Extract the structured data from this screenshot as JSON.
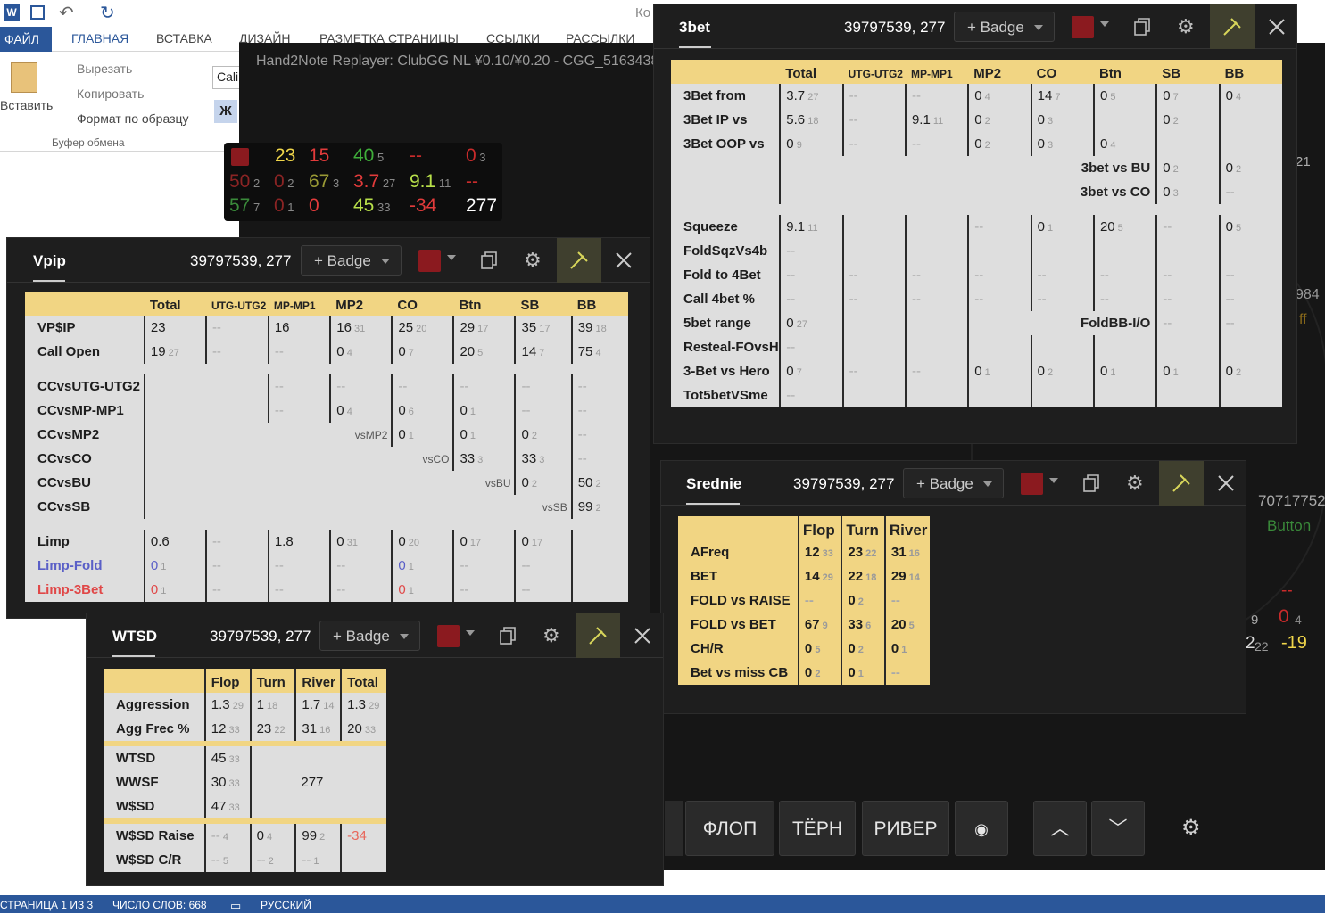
{
  "word": {
    "tabs": [
      "ФАЙЛ",
      "ГЛАВНАЯ",
      "ВСТАВКА",
      "ДИЗАЙН",
      "РАЗМЕТКА СТРАНИЦЫ",
      "ССЫЛКИ",
      "РАССЫЛКИ"
    ],
    "title_partial": "Ко",
    "paste": "Вставить",
    "cut": "Вырезать",
    "copy": "Копировать",
    "format": "Формат по образцу",
    "group": "Буфер обмена",
    "font_partial": "Cali",
    "bold": "Ж",
    "status": {
      "page": "СТРАНИЦА 1 ИЗ 3",
      "words": "ЧИСЛО СЛОВ: 668",
      "lang": "РУССКИЙ"
    }
  },
  "replayer": {
    "title": "Hand2Note Replayer: ClubGG NL ¥0.10/¥0.20 - CGG_5163438",
    "hud": [
      {
        "v": "23",
        "c": "#f0d64a"
      },
      {
        "v": "15",
        "c": "#e23b3b"
      },
      {
        "v": "40",
        "n": "5",
        "c": "#3fae3a"
      },
      {
        "v": "--",
        "c": "#c92b2b"
      },
      {
        "v": "0",
        "n": "3",
        "c": "#c92b2b"
      },
      {
        "v": "50",
        "n": "2",
        "c": "#8b2424"
      },
      {
        "v": "0",
        "n": "2",
        "c": "#8b2424"
      },
      {
        "v": "67",
        "n": "3",
        "c": "#9a9a35"
      },
      {
        "v": "3.7",
        "n": "27",
        "c": "#e23b3b"
      },
      {
        "v": "9.1",
        "n": "11",
        "c": "#b8e04a"
      },
      {
        "v": "--",
        "c": "#c92b2b"
      },
      {
        "v": "57",
        "n": "7",
        "c": "#3a8a3a"
      },
      {
        "v": "0",
        "n": "1",
        "c": "#8b2424"
      },
      {
        "v": "0",
        "c": "#e23b3b"
      },
      {
        "v": "45",
        "n": "33",
        "c": "#b8e04a"
      },
      {
        "v": "-34",
        "c": "#e23b3b"
      },
      {
        "v": "277",
        "c": "#ffffff"
      }
    ],
    "side_texts": [
      "21",
      "984",
      "ff",
      "70717752",
      "Button",
      "--",
      "9",
      "0",
      "4",
      "2",
      "22",
      "-19"
    ],
    "buttons": [
      "ФЛОП",
      "ТЁРН",
      "РИВЕР"
    ]
  },
  "popups": {
    "id": "39797539, 277",
    "badge": "+ Badge",
    "vpip": {
      "title": "Vpip",
      "header": [
        "Total",
        "UTG-UTG2",
        "MP-MP1",
        "MP2",
        "CO",
        "Btn",
        "SB",
        "BB"
      ],
      "rows": [
        [
          "VP$IP",
          "23",
          "",
          "--",
          "",
          "16",
          "",
          "16",
          "31",
          "25",
          "20",
          "29",
          "17",
          "35",
          "17",
          "39",
          "18"
        ],
        [
          "Call Open",
          "19",
          "27",
          "--",
          "",
          "--",
          "",
          "0",
          "4",
          "0",
          "7",
          "20",
          "5",
          "14",
          "7",
          "75",
          "4"
        ]
      ],
      "cc_rows": [
        [
          "CCvsUTG-UTG2",
          "--",
          "--",
          "--",
          "--",
          "--",
          "--"
        ],
        [
          "CCvsMP-MP1",
          "--",
          "0|4",
          "0|6",
          "0|1",
          "--",
          "--"
        ],
        [
          "CCvsMP2",
          "vsMP2",
          "0|1",
          "0|1",
          "0|2",
          "--"
        ],
        [
          "CCvsCO",
          "vsCO",
          "33|3",
          "33|3",
          "--"
        ],
        [
          "CCvsBU",
          "vsBU",
          "0|2",
          "50|2"
        ],
        [
          "CCvsSB",
          "vsSB",
          "99|2"
        ]
      ],
      "limp_rows": [
        [
          "Limp",
          "0.6",
          "",
          "--",
          "",
          "1.8",
          "",
          "0",
          "31",
          "0",
          "20",
          "0",
          "17",
          "0",
          "17",
          "",
          ""
        ],
        [
          "Limp-Fold",
          "0",
          "1",
          "--",
          "",
          "--",
          "",
          "--",
          "",
          "0",
          "1",
          "--",
          "",
          "--",
          "",
          "",
          ""
        ],
        [
          "Limp-3Bet",
          "0",
          "1",
          "--",
          "",
          "--",
          "",
          "--",
          "",
          "0",
          "1",
          "--",
          "",
          "--",
          "",
          "",
          ""
        ]
      ]
    },
    "threebet": {
      "title": "3bet",
      "header": [
        "Total",
        "UTG-UTG2",
        "MP-MP1",
        "MP2",
        "CO",
        "Btn",
        "SB",
        "BB"
      ],
      "rows": [
        [
          "3Bet from",
          "3.7|27",
          "--",
          "--",
          "0|4",
          "14|7",
          "0|5",
          "0|7",
          "0|4"
        ],
        [
          "3Bet IP vs",
          "5.6|18",
          "--",
          "9.1|11",
          "0|2",
          "0|3",
          "",
          "0|2",
          ""
        ],
        [
          "3Bet OOP vs",
          "0|9",
          "--",
          "--",
          "0|2",
          "0|3",
          "0|4",
          "",
          ""
        ]
      ],
      "vs_rows": [
        [
          "3bet vs BU",
          "0|2",
          "0|2"
        ],
        [
          "3bet vs CO",
          "0|3",
          "--"
        ]
      ],
      "rows2": [
        [
          "Squeeze",
          "9.1|11",
          "",
          "",
          "--",
          "0|1",
          "20|5",
          "--",
          "0|5"
        ],
        [
          "FoldSqzVs4b",
          "--",
          "",
          "",
          "",
          "",
          "",
          "",
          ""
        ],
        [
          "Fold to 4Bet",
          "--",
          "--",
          "--",
          "--",
          "--",
          "--",
          "--",
          "--"
        ],
        [
          "Call 4bet %",
          "--",
          "--",
          "--",
          "--",
          "--",
          "--",
          "--",
          "--"
        ],
        [
          "5bet range",
          "0|27",
          "",
          "",
          "",
          "FoldBB-I/O",
          "",
          "--",
          "--"
        ],
        [
          "Resteal-FOvsH",
          "--",
          "",
          "",
          "",
          "",
          "",
          "",
          ""
        ],
        [
          "3-Bet vs Hero",
          "0|7",
          "--",
          "--",
          "0|1",
          "0|2",
          "0|1",
          "0|1",
          "0|2"
        ],
        [
          "Tot5betVSme",
          "--",
          "",
          "",
          "",
          "",
          "",
          "",
          ""
        ]
      ]
    },
    "srednie": {
      "title": "Srednie",
      "header": [
        "Flop",
        "Turn",
        "River"
      ],
      "rows": [
        [
          "AFreq",
          "12|33",
          "23|22",
          "31|16"
        ],
        [
          "BET",
          "14|29",
          "22|18",
          "29|14"
        ],
        [
          "FOLD vs RAISE",
          "--",
          "0|2",
          "--"
        ],
        [
          "FOLD vs BET",
          "67|9",
          "33|6",
          "20|5"
        ],
        [
          "CH/R",
          "0|5",
          "0|2",
          "0|1"
        ],
        [
          "Bet vs miss CB",
          "0|2",
          "0|1",
          "--"
        ]
      ]
    },
    "wtsd": {
      "title": "WTSD",
      "header": [
        "Flop",
        "Turn",
        "River",
        "Total"
      ],
      "rows": [
        [
          "Aggression",
          "1.3|29",
          "1|18",
          "1.7|14",
          "1.3|29"
        ],
        [
          "Agg Frec %",
          "12|33",
          "23|22",
          "31|16",
          "20|33"
        ]
      ],
      "rows2": [
        [
          "WTSD",
          "45|33"
        ],
        [
          "WWSF",
          "30|33",
          "277"
        ],
        [
          "W$SD",
          "47|33"
        ]
      ],
      "rows3": [
        [
          "W$SD Raise",
          "--|4",
          "0|4",
          "99|2",
          "-34"
        ],
        [
          "W$SD C/R",
          "--|5",
          "--|2",
          "--|1",
          ""
        ]
      ]
    }
  }
}
